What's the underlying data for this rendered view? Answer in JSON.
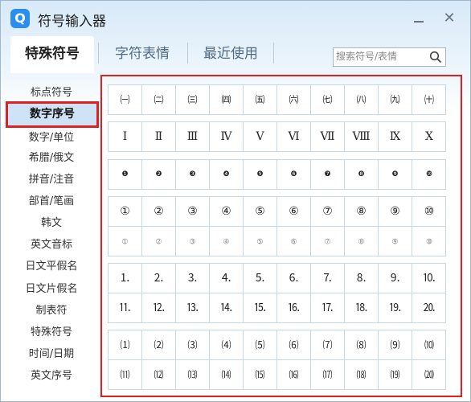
{
  "window": {
    "title": "符号输入器"
  },
  "tabs": [
    "特殊符号",
    "字符表情",
    "最近使用"
  ],
  "search": {
    "placeholder": "搜索符号/表情"
  },
  "sidebar": {
    "items": [
      "标点符号",
      "数字序号",
      "数字/单位",
      "希腊/俄文",
      "拼音/注音",
      "部首/笔画",
      "韩文",
      "英文音标",
      "日文平假名",
      "日文片假名",
      "制表符",
      "特殊符号",
      "时间/日期",
      "英文序号"
    ],
    "active": "数字序号"
  },
  "symbol_groups": [
    {
      "rows": [
        [
          "㈠",
          "㈡",
          "㈢",
          "㈣",
          "㈤",
          "㈥",
          "㈦",
          "㈧",
          "㈨",
          "㈩"
        ]
      ]
    },
    {
      "rows": [
        [
          "Ⅰ",
          "Ⅱ",
          "Ⅲ",
          "Ⅳ",
          "Ⅴ",
          "Ⅵ",
          "Ⅶ",
          "Ⅷ",
          "Ⅸ",
          "Ⅹ"
        ]
      ]
    },
    {
      "rows": [
        [
          "❶",
          "❷",
          "❸",
          "❹",
          "❺",
          "❻",
          "❼",
          "❽",
          "❾",
          "❿"
        ]
      ]
    },
    {
      "rows": [
        [
          "①",
          "②",
          "③",
          "④",
          "⑤",
          "⑥",
          "⑦",
          "⑧",
          "⑨",
          "⑩"
        ],
        [
          "➀",
          "➁",
          "➂",
          "➃",
          "➄",
          "➅",
          "➆",
          "➇",
          "➈",
          "➉"
        ]
      ]
    },
    {
      "rows": [
        [
          "⒈",
          "⒉",
          "⒊",
          "⒋",
          "⒌",
          "⒍",
          "⒎",
          "⒏",
          "⒐",
          "⒑"
        ],
        [
          "⒒",
          "⒓",
          "⒔",
          "⒕",
          "⒖",
          "⒗",
          "⒘",
          "⒙",
          "⒚",
          "⒛"
        ]
      ]
    },
    {
      "rows": [
        [
          "⑴",
          "⑵",
          "⑶",
          "⑷",
          "⑸",
          "⑹",
          "⑺",
          "⑻",
          "⑼",
          "⑽"
        ],
        [
          "⑾",
          "⑿",
          "⒀",
          "⒁",
          "⒂",
          "⒃",
          "⒄",
          "⒅",
          "⒆",
          "⒇"
        ]
      ]
    }
  ],
  "icons": {
    "app": "q-logo-icon",
    "minimize": "minimize-icon",
    "close": "close-icon",
    "search": "search-icon"
  },
  "colors": {
    "highlight_outline": "#e02020",
    "active_side_bg": "#cfe3f6",
    "app_icon": "#2a8ef0"
  }
}
